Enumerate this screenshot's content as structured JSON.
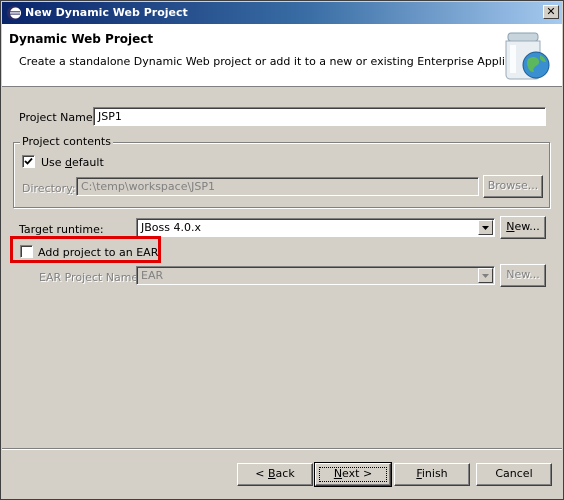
{
  "window": {
    "title": "New Dynamic Web Project",
    "close_symbol": "✕"
  },
  "header": {
    "title": "Dynamic Web Project",
    "description": "Create a standalone Dynamic Web project or add it to a new or existing Enterprise Application."
  },
  "form": {
    "project_name_label": "Project Name:",
    "project_name_value": "JSP1",
    "project_contents": {
      "group_label": "Project contents",
      "use_default_label_pre": "Use ",
      "use_default_label_u": "d",
      "use_default_label_post": "efault",
      "use_default_checked": true,
      "directory_label_pre": "Director",
      "directory_label_u": "y",
      "directory_label_post": ":",
      "directory_value": "C:\\temp\\workspace\\JSP1",
      "browse_label": "Browse..."
    },
    "target_runtime_label": "Target runtime:",
    "target_runtime_value": "JBoss 4.0.x",
    "target_runtime_new_pre": "",
    "target_runtime_new_u": "N",
    "target_runtime_new_post": "ew...",
    "add_to_ear_label": "Add project to an EAR",
    "add_to_ear_checked": false,
    "ear_project_name_label": "EAR Project Name:",
    "ear_project_name_value": "EAR",
    "ear_new_label": "New..."
  },
  "footer": {
    "back_pre": "< ",
    "back_u": "B",
    "back_post": "ack",
    "next_pre": "",
    "next_u": "N",
    "next_post": "ext >",
    "finish_pre": "",
    "finish_u": "F",
    "finish_post": "inish",
    "cancel_label": "Cancel"
  },
  "colors": {
    "highlight": "#e00000",
    "dialog_bg": "#d4d0c8",
    "title_gradient_start": "#0a246a"
  }
}
